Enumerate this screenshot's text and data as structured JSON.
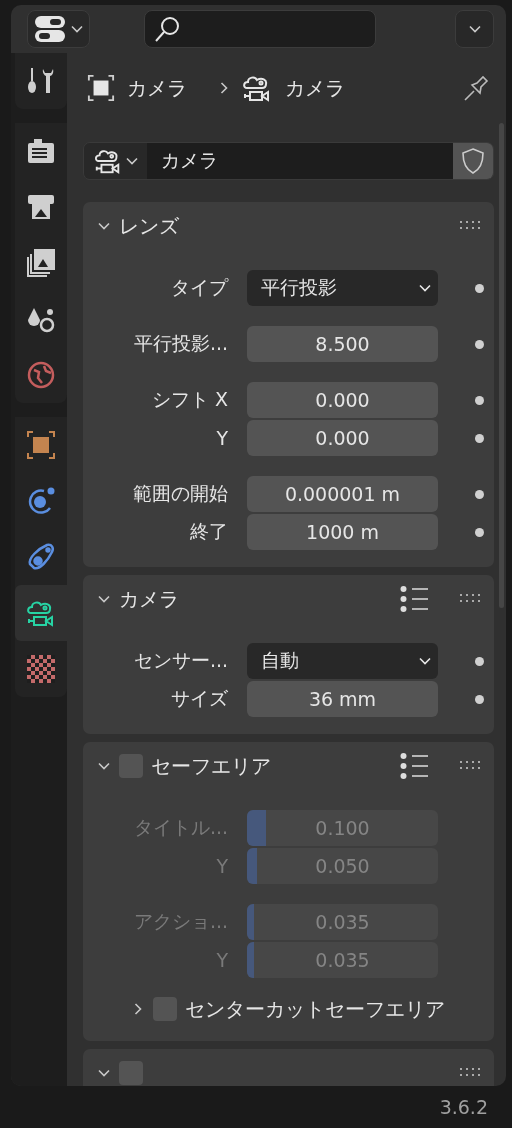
{
  "sidebar": {
    "groups": [
      {
        "tabs": [
          {
            "kind": "tool",
            "selected": false
          }
        ]
      },
      {
        "tabs": [
          {
            "kind": "render",
            "selected": false
          },
          {
            "kind": "output",
            "selected": false
          },
          {
            "kind": "view_layer",
            "selected": false
          },
          {
            "kind": "scene",
            "selected": false
          },
          {
            "kind": "world",
            "selected": false
          }
        ]
      },
      {
        "tabs": [
          {
            "kind": "object",
            "selected": false
          },
          {
            "kind": "physics",
            "selected": false
          },
          {
            "kind": "constraints",
            "selected": false
          },
          {
            "kind": "camera",
            "selected": true
          },
          {
            "kind": "texture",
            "selected": false
          }
        ]
      }
    ]
  },
  "breadcrumb": [
    {
      "kind": "object",
      "label": "カメラ"
    },
    {
      "kind": "camera",
      "label": "カメラ"
    }
  ],
  "datablock": {
    "name": "カメラ"
  },
  "panels": [
    {
      "title": "レンズ",
      "expanded": true,
      "presets": false,
      "groups": [
        [
          {
            "label": "タイプ",
            "kind": "dropdown",
            "value": "平行投影",
            "decorator": true
          }
        ],
        [
          {
            "label": "平行投影...",
            "kind": "number",
            "value": "8.500",
            "decorator": true
          }
        ],
        [
          {
            "label": "シフト X",
            "kind": "number",
            "value": "0.000",
            "decorator": true
          },
          {
            "label": "Y",
            "kind": "number",
            "value": "0.000",
            "decorator": true
          }
        ],
        [
          {
            "label": "範囲の開始",
            "kind": "number",
            "value": "0.000001 m",
            "decorator": true
          },
          {
            "label": "終了",
            "kind": "number",
            "value": "1000 m",
            "decorator": true
          }
        ]
      ]
    },
    {
      "title": "カメラ",
      "expanded": true,
      "presets": true,
      "groups": [
        [
          {
            "label": "センサー...",
            "kind": "dropdown",
            "value": "自動",
            "decorator": true
          },
          {
            "label": "サイズ",
            "kind": "number",
            "value": "36 mm",
            "decorator": true
          }
        ]
      ]
    },
    {
      "title": "セーフエリア",
      "expanded": true,
      "presets": true,
      "checkbox": {
        "checked": false
      },
      "disabled": true,
      "groups": [
        [
          {
            "label": "タイトル...",
            "kind": "slider",
            "value": "0.100",
            "level": 0.1,
            "decorator": false
          },
          {
            "label": "Y",
            "kind": "slider",
            "value": "0.050",
            "level": 0.05,
            "decorator": false
          }
        ],
        [
          {
            "label": "アクショ...",
            "kind": "slider",
            "value": "0.035",
            "level": 0.035,
            "decorator": false
          },
          {
            "label": "Y",
            "kind": "slider",
            "value": "0.035",
            "level": 0.035,
            "decorator": false
          }
        ]
      ],
      "subpanels": [
        {
          "title": "センターカットセーフエリア",
          "expanded": false,
          "checkbox": {
            "checked": false
          }
        }
      ]
    },
    {
      "expanded": true,
      "presets": false,
      "checkbox": {
        "checked": false
      }
    }
  ],
  "status_bar": {
    "version": "3.6.2"
  }
}
